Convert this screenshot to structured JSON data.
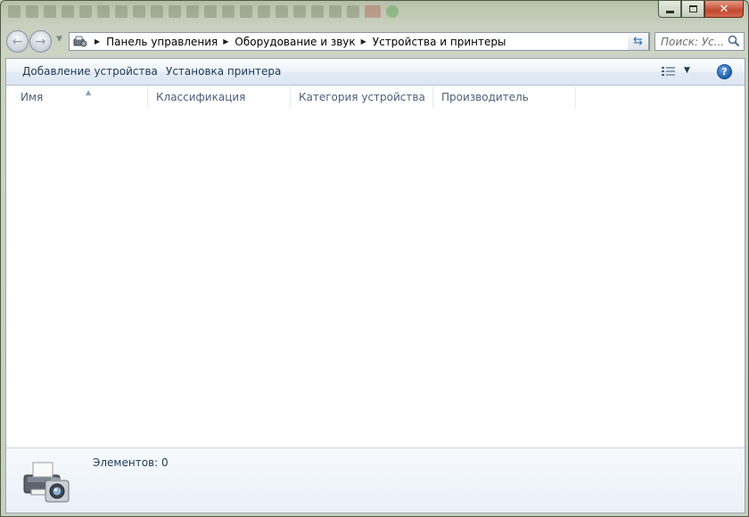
{
  "address": {
    "crumbs": [
      "Панель управления",
      "Оборудование и звук",
      "Устройства и принтеры"
    ]
  },
  "search": {
    "placeholder": "Поиск: Ус..."
  },
  "toolbar": {
    "add_device": "Добавление устройства",
    "add_printer": "Установка принтера"
  },
  "columns": [
    "Имя",
    "Классификация",
    "Категория устройства",
    "Производитель"
  ],
  "details": {
    "items_count": "Элементов: 0"
  },
  "icons": {
    "address": "devices-printers-icon",
    "help": "help-icon",
    "view": "view-options-icon",
    "device": "printer-camera-icon"
  },
  "colors": {
    "link_text": "#1e3955",
    "close_button": "#c1492f",
    "help_blue": "#1d5fb0"
  }
}
